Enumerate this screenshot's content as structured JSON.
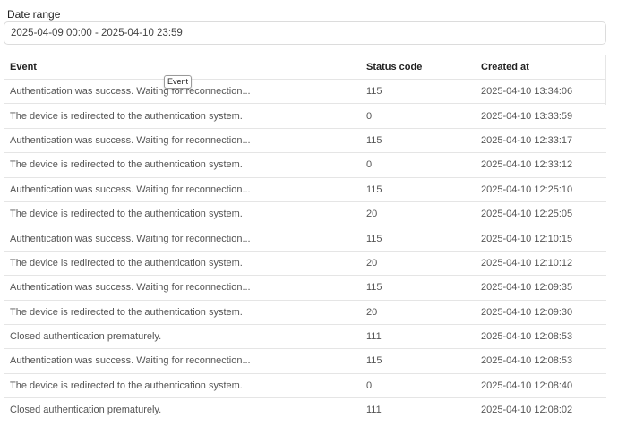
{
  "filters": {
    "date_range_label": "Date range",
    "date_range_value": "2025-04-09 00:00 - 2025-04-10 23:59"
  },
  "table": {
    "columns": {
      "event": "Event",
      "status_code": "Status code",
      "created_at": "Created at"
    },
    "rows": [
      {
        "event": "Authentication was success. Waiting for reconnection...",
        "status_code": "115",
        "created_at": "2025-04-10 13:34:06"
      },
      {
        "event": "The device is redirected to the authentication system.",
        "status_code": "0",
        "created_at": "2025-04-10 13:33:59"
      },
      {
        "event": "Authentication was success. Waiting for reconnection...",
        "status_code": "115",
        "created_at": "2025-04-10 12:33:17"
      },
      {
        "event": "The device is redirected to the authentication system.",
        "status_code": "0",
        "created_at": "2025-04-10 12:33:12"
      },
      {
        "event": "Authentication was success. Waiting for reconnection...",
        "status_code": "115",
        "created_at": "2025-04-10 12:25:10"
      },
      {
        "event": "The device is redirected to the authentication system.",
        "status_code": "20",
        "created_at": "2025-04-10 12:25:05"
      },
      {
        "event": "Authentication was success. Waiting for reconnection...",
        "status_code": "115",
        "created_at": "2025-04-10 12:10:15"
      },
      {
        "event": "The device is redirected to the authentication system.",
        "status_code": "20",
        "created_at": "2025-04-10 12:10:12"
      },
      {
        "event": "Authentication was success. Waiting for reconnection...",
        "status_code": "115",
        "created_at": "2025-04-10 12:09:35"
      },
      {
        "event": "The device is redirected to the authentication system.",
        "status_code": "20",
        "created_at": "2025-04-10 12:09:30"
      },
      {
        "event": "Closed authentication prematurely.",
        "status_code": "111",
        "created_at": "2025-04-10 12:08:53"
      },
      {
        "event": "Authentication was success. Waiting for reconnection...",
        "status_code": "115",
        "created_at": "2025-04-10 12:08:53"
      },
      {
        "event": "The device is redirected to the authentication system.",
        "status_code": "0",
        "created_at": "2025-04-10 12:08:40"
      },
      {
        "event": "Closed authentication prematurely.",
        "status_code": "111",
        "created_at": "2025-04-10 12:08:02"
      }
    ]
  },
  "tooltip": {
    "text": "Event"
  }
}
